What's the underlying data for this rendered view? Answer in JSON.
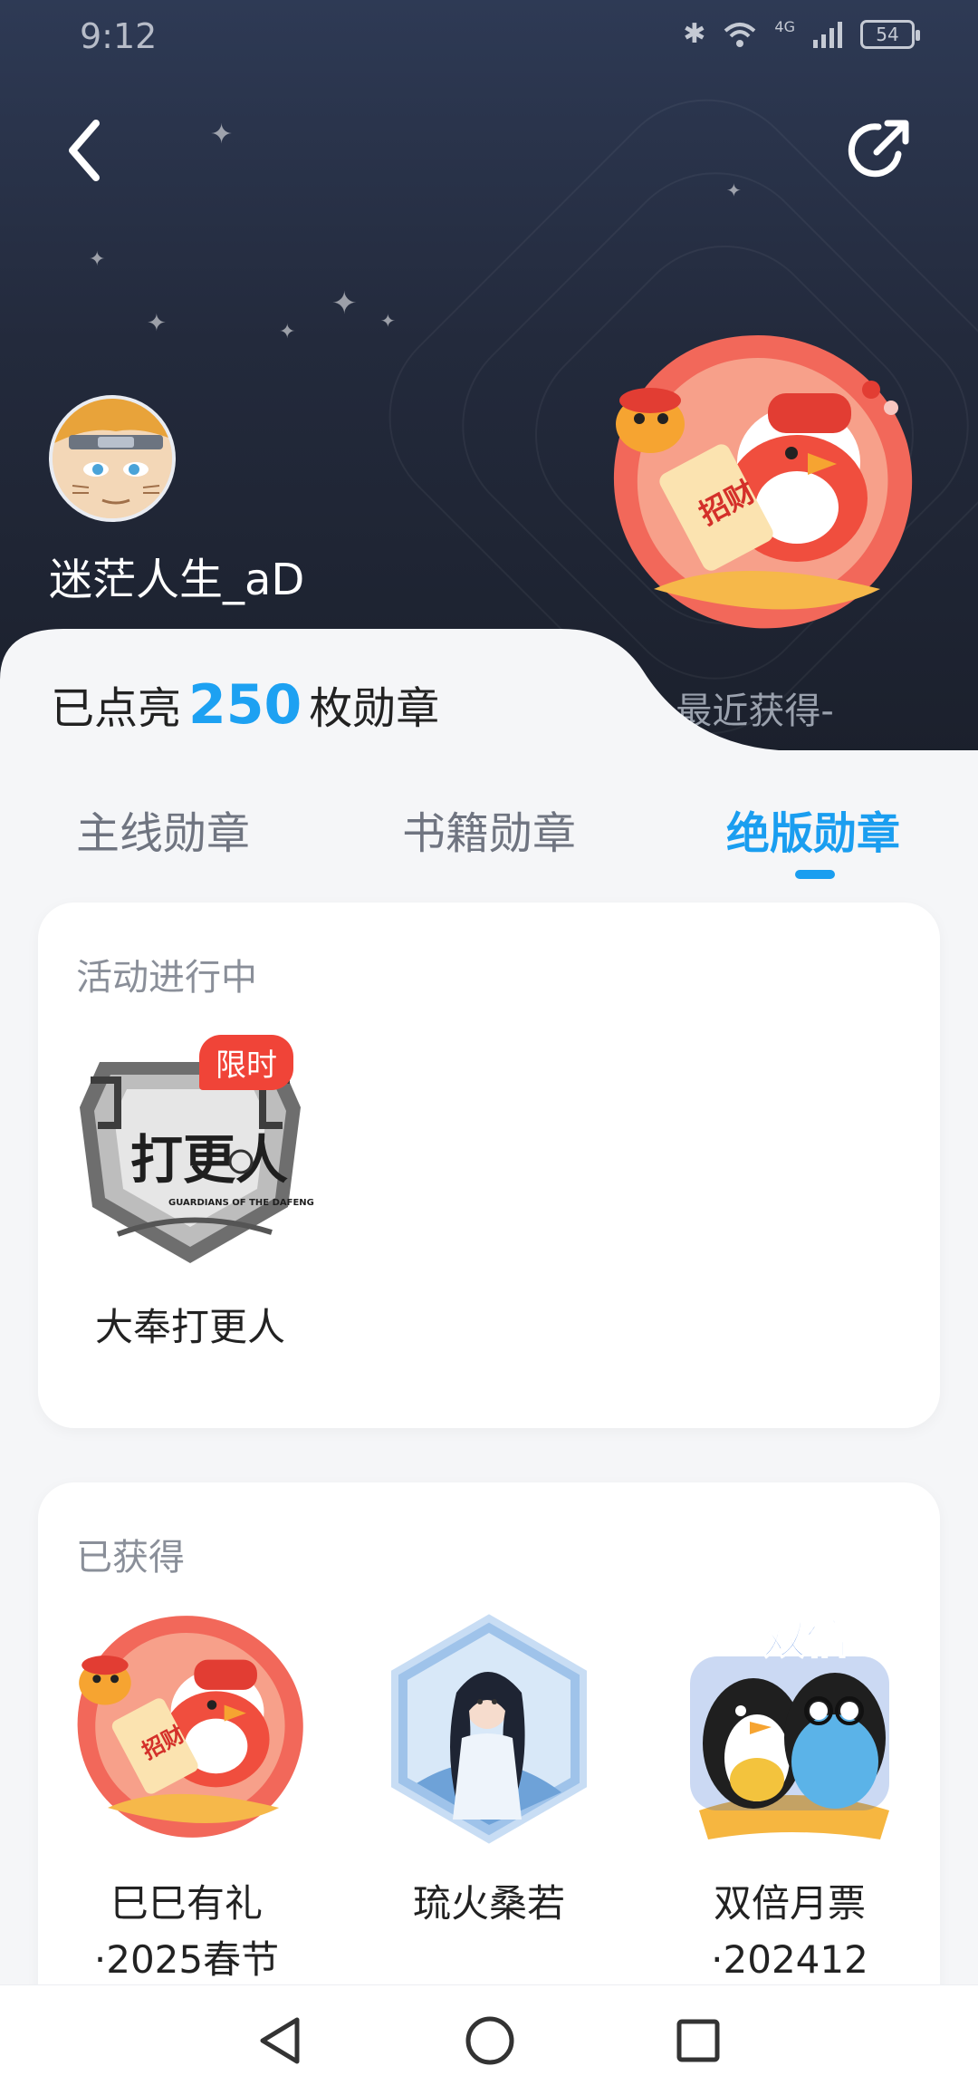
{
  "status_bar": {
    "time": "9:12",
    "bluetooth_icon": "bluetooth-icon",
    "wifi_icon": "wifi-icon",
    "network_type": "4G",
    "battery_level": "54"
  },
  "header": {
    "back_icon": "chevron-left-icon",
    "share_icon": "share-icon",
    "username": "迷茫人生_aD",
    "recent_label": "-最近获得-"
  },
  "summary": {
    "prefix": "已点亮",
    "count": "250",
    "suffix": "枚勋章"
  },
  "tabs": [
    {
      "label": "主线勋章",
      "active": false
    },
    {
      "label": "书籍勋章",
      "active": false
    },
    {
      "label": "绝版勋章",
      "active": true
    }
  ],
  "ongoing_section": {
    "title": "活动进行中",
    "items": [
      {
        "name": "大奉打更人",
        "tag": "限时",
        "seal_text": "打更人",
        "seal_sub": "GUARDIANS OF THE DAFENG"
      }
    ]
  },
  "obtained_section": {
    "title": "已获得",
    "items": [
      {
        "name_line1": "巳巳有礼",
        "name_line2": "·2025春节",
        "seal_text": "招财"
      },
      {
        "name_line1": "琉火桑若",
        "name_line2": ""
      },
      {
        "name_line1": "双倍月票",
        "name_line2": "·202412",
        "seal_text": "双倍"
      }
    ]
  },
  "colors": {
    "accent": "#1a9ef0",
    "limit_tag": "#f04438",
    "header_dark": "#232a3c"
  }
}
